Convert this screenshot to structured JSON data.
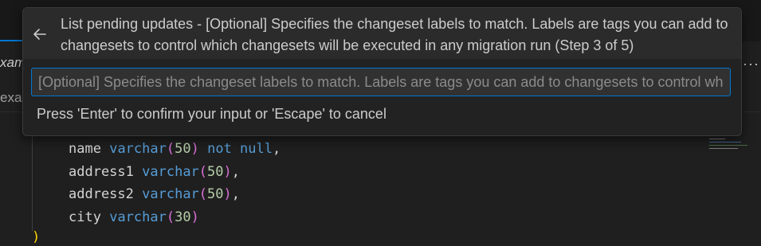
{
  "editor_fragments": {
    "tab_label_fragment": "xam",
    "breadcrumb_fragment": "exar",
    "more_actions": "···"
  },
  "quick_input": {
    "title": "List pending updates - [Optional] Specifies the changeset labels to match. Labels are tags you can add to changesets to control which changesets will be executed in any migration run (Step 3 of 5)",
    "input_placeholder": "[Optional] Specifies the changeset labels to match. Labels are tags you can add to changesets to control which changesets will be executed in any migration run",
    "input_value": "",
    "message": "Press 'Enter' to confirm your input or 'Escape' to cancel",
    "back_icon": "arrow-left-icon"
  },
  "code": {
    "lines": [
      {
        "ident": "name",
        "type": "varchar",
        "size": "50",
        "suffix": "not null",
        "end": ","
      },
      {
        "ident": "address1",
        "type": "varchar",
        "size": "50",
        "suffix": "",
        "end": ","
      },
      {
        "ident": "address2",
        "type": "varchar",
        "size": "50",
        "suffix": "",
        "end": ","
      },
      {
        "ident": "city",
        "type": "varchar",
        "size": "30",
        "suffix": "",
        "end": ""
      }
    ],
    "closing": ")"
  },
  "colors": {
    "accent": "#0078d4",
    "keyword": "#569cd6",
    "number": "#b5cea8",
    "bracket": "#da70d6",
    "closing_bracket": "#ffd700"
  }
}
